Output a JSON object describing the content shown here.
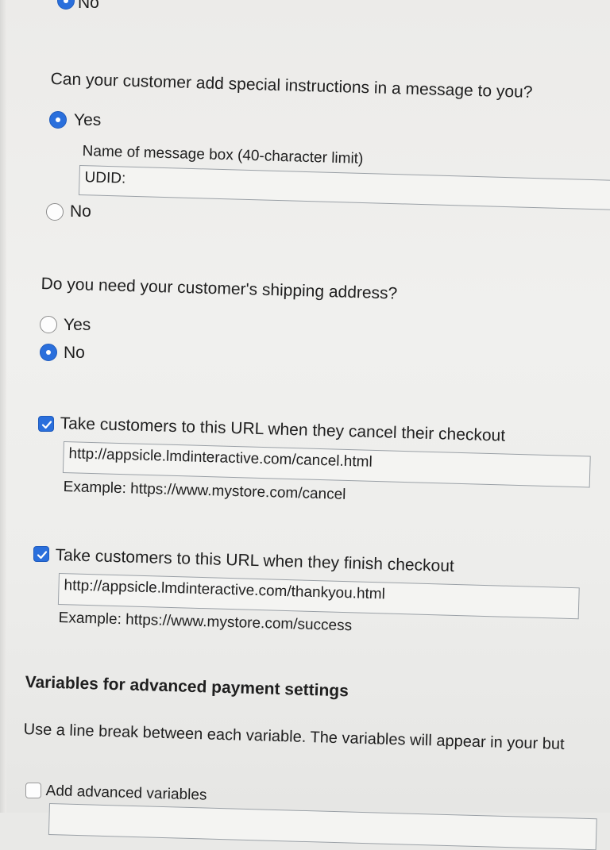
{
  "special_instructions": {
    "prev_no_label": "No",
    "question": "Can your customer add special instructions in a message to you?",
    "yes_label": "Yes",
    "no_label": "No",
    "selected": "yes",
    "message_box_label": "Name of message box (40-character limit)",
    "message_box_value": "UDID:"
  },
  "shipping": {
    "question": "Do you need your customer's shipping address?",
    "yes_label": "Yes",
    "no_label": "No",
    "selected": "no"
  },
  "cancel_url": {
    "checked": true,
    "label": "Take customers to this URL when they cancel their checkout",
    "value": "http://appsicle.lmdinteractive.com/cancel.html",
    "example": "Example: https://www.mystore.com/cancel"
  },
  "finish_url": {
    "checked": true,
    "label": "Take customers to this URL when they finish checkout",
    "value": "http://appsicle.lmdinteractive.com/thankyou.html",
    "example": "Example: https://www.mystore.com/success"
  },
  "advanced": {
    "heading": "Variables for advanced payment settings",
    "description": "Use a line break between each variable. The variables will appear in your but",
    "checkbox_label": "Add advanced variables",
    "checked": false
  },
  "colors": {
    "accent": "#2a6fdc",
    "text": "#1f1f1f",
    "border": "#9aa0a6"
  }
}
